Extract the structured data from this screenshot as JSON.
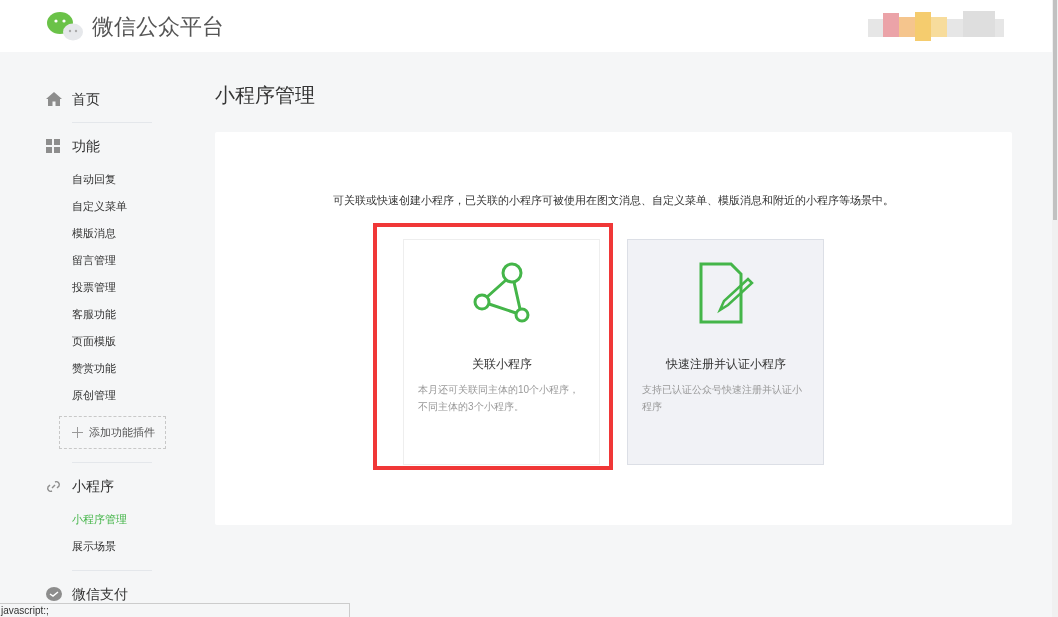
{
  "header": {
    "title": "微信公众平台"
  },
  "sidebar": {
    "sections": [
      {
        "kind": "home",
        "label": "首页"
      },
      {
        "kind": "features",
        "label": "功能",
        "items": [
          {
            "label": "自动回复",
            "selected": false
          },
          {
            "label": "自定义菜单",
            "selected": false
          },
          {
            "label": "模版消息",
            "selected": false
          },
          {
            "label": "留言管理",
            "selected": false
          },
          {
            "label": "投票管理",
            "selected": false
          },
          {
            "label": "客服功能",
            "selected": false
          },
          {
            "label": "页面模版",
            "selected": false
          },
          {
            "label": "赞赏功能",
            "selected": false
          },
          {
            "label": "原创管理",
            "selected": false
          }
        ],
        "add_button": "添加功能插件"
      },
      {
        "kind": "miniprogram",
        "label": "小程序",
        "items": [
          {
            "label": "小程序管理",
            "selected": true
          },
          {
            "label": "展示场景",
            "selected": false
          }
        ]
      },
      {
        "kind": "payment",
        "label": "微信支付"
      }
    ]
  },
  "main": {
    "title": "小程序管理",
    "description": "可关联或快速创建小程序，已关联的小程序可被使用在图文消息、自定义菜单、模版消息和附近的小程序等场景中。",
    "cards": [
      {
        "kind": "link",
        "title": "关联小程序",
        "text": "本月还可关联同主体的10个小程序，不同主体的3个小程序。",
        "highlighted": true,
        "hovered": false
      },
      {
        "kind": "register",
        "title": "快速注册并认证小程序",
        "text": "支持已认证公众号快速注册并认证小程序",
        "highlighted": false,
        "hovered": true
      }
    ]
  },
  "status_bar": {
    "text": "javascript:;"
  }
}
